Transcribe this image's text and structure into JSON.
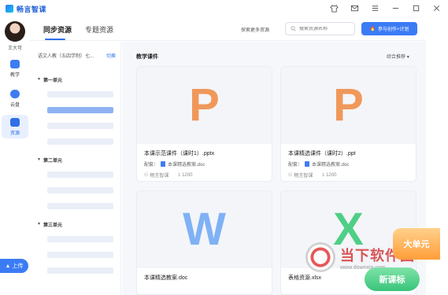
{
  "app": {
    "title": "畅言智课",
    "logo_icon": "app-logo-icon"
  },
  "window_controls": [
    {
      "name": "skin-icon"
    },
    {
      "name": "message-icon"
    },
    {
      "name": "menu-icon"
    },
    {
      "name": "minimize-icon"
    },
    {
      "name": "maximize-icon"
    },
    {
      "name": "close-icon"
    }
  ],
  "user": {
    "name": "王大可"
  },
  "rail": {
    "items": [
      {
        "label": "教学",
        "icon": "teach-icon"
      },
      {
        "label": "云盘",
        "icon": "cloud-icon"
      },
      {
        "label": "资源",
        "icon": "resource-icon",
        "active": true
      }
    ],
    "upload_label": "上传"
  },
  "tabs": [
    {
      "label": "同步资源",
      "active": true
    },
    {
      "label": "专题资源",
      "active": false
    }
  ],
  "header": {
    "explore_label": "探索更多资源",
    "search_placeholder": "搜索资源名称",
    "create_label": "参与创作+计划"
  },
  "catalog": {
    "book": "语文人教（五四学制）七...",
    "switch_label": "切换",
    "units": [
      {
        "title": "第一单元"
      },
      {
        "title": "第二单元"
      },
      {
        "title": "第三单元"
      }
    ]
  },
  "main": {
    "section_title": "教学课件",
    "sort_label": "综合推荐"
  },
  "cards": [
    {
      "glyph": "P",
      "color": "#f0985a",
      "name": "本课示范课件（课时1）.pptx",
      "pair_label": "配套：",
      "pair_doc": "本课精选教案.doc",
      "author": "畅言智课",
      "downloads": "1200"
    },
    {
      "glyph": "P",
      "color": "#f0985a",
      "name": "本课精选课件（课时2）.ppt",
      "pair_label": "配套：",
      "pair_doc": "本课精选教案.doc",
      "author": "畅言智课",
      "downloads": "1200"
    },
    {
      "glyph": "W",
      "color": "#7fb1f5",
      "name": "本课精选教案.doc"
    },
    {
      "glyph": "X",
      "color": "#4fcf86",
      "name": "表格资源.xlsx"
    }
  ],
  "promos": {
    "big_unit": "大单元",
    "new_course": "新课标"
  },
  "watermark": {
    "text": "当下软件园",
    "url": "www.downxia.com"
  }
}
